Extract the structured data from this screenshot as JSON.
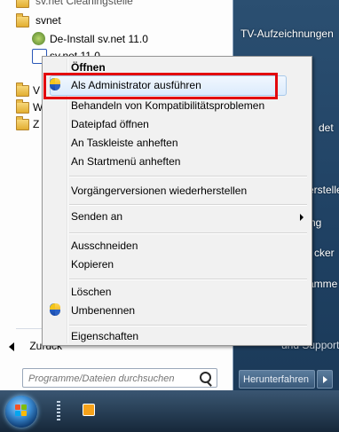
{
  "program_list": {
    "item_top_truncated": "sv.net Cleaningstelle",
    "folder_svnet": "svnet",
    "deinstall": "De-Install sv.net 11.0",
    "svnet_app": "sv.net 11.0",
    "back_label": "Zurück"
  },
  "search": {
    "placeholder": "Programme/Dateien durchsuchen"
  },
  "right_pane": {
    "items": [
      "TV-Aufzeichnungen",
      "det",
      "erstelle",
      "ng",
      "cker",
      "amme",
      "und Support"
    ],
    "shutdown_label": "Herunterfahren"
  },
  "context_menu": {
    "items": [
      "Öffnen",
      "Als Administrator ausführen",
      "Behandeln von Kompatibilitätsproblemen",
      "Dateipfad öffnen",
      "An Taskleiste anheften",
      "An Startmenü anheften",
      "Vorgängerversionen wiederherstellen",
      "Senden an",
      "Ausschneiden",
      "Kopieren",
      "Löschen",
      "Umbenennen",
      "Eigenschaften"
    ]
  },
  "colors": {
    "highlight_border": "#e3070d",
    "hover_fill": "#dcebfc"
  }
}
